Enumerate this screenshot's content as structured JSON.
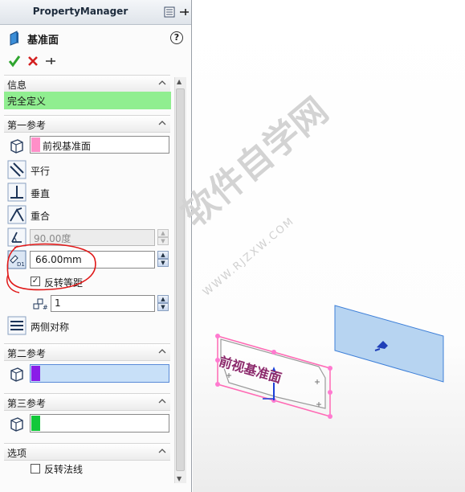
{
  "property_manager": {
    "title": "PropertyManager",
    "feature_name": "基准面",
    "help_glyph": "?",
    "info": {
      "header": "信息",
      "status": "完全定义",
      "status_color": "#90ee90"
    },
    "first_reference": {
      "header": "第一参考",
      "selection": "前视基准面",
      "selection_color": "#ff8fc8",
      "constraints": [
        "平行",
        "垂直",
        "重合"
      ],
      "angle_value": "90.00度",
      "distance_value": "66.00mm",
      "flip_offset_label": "反转等距",
      "flip_offset_checked": true,
      "instances_value": "1",
      "mid_plane_label": "两侧对称"
    },
    "second_reference": {
      "header": "第二参考",
      "selection_color": "#8a1de8",
      "field_bg": "#c8e0f8"
    },
    "third_reference": {
      "header": "第三参考",
      "selection_color": "#12c83a"
    },
    "options": {
      "header": "选项",
      "flip_normal_label": "反转法线",
      "flip_normal_checked": false
    }
  },
  "viewport": {
    "plane_label": "前视基准面",
    "preview_plane_color": "#aaccee",
    "reference_plane_color": "#ff69b4",
    "watermark": "软件自学网",
    "watermark_url": "WWW.RJZXW.COM"
  }
}
